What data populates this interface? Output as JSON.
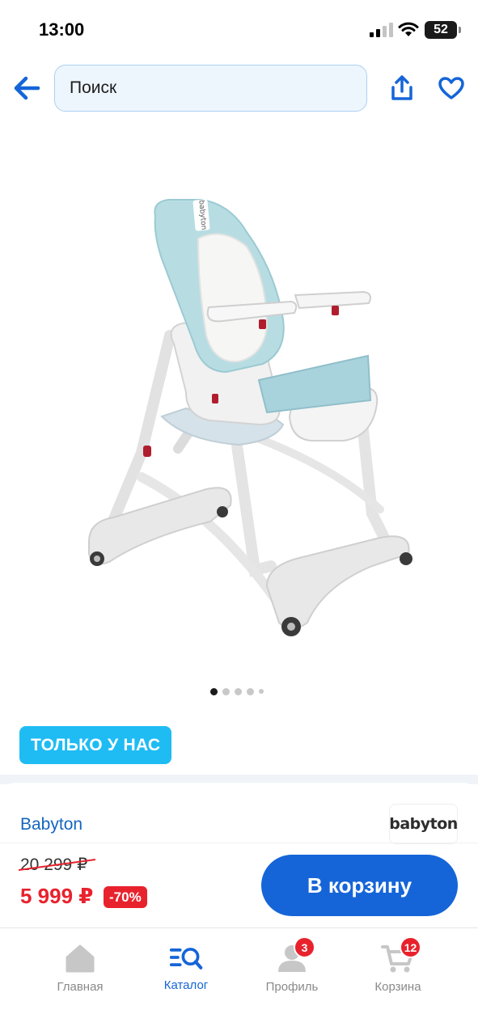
{
  "status_bar": {
    "time": "13:00",
    "battery": "52"
  },
  "header": {
    "search_placeholder": "Поиск"
  },
  "gallery": {
    "image_count": 5,
    "active_index": 0
  },
  "product": {
    "badge": "ТОЛЬКО У НАС",
    "brand": "Babyton",
    "brand_logo": "babyton",
    "image_logo": "babyton",
    "old_price": "20 299 ₽",
    "price": "5 999 ₽",
    "discount": "-70%"
  },
  "actions": {
    "add_to_cart": "В корзину"
  },
  "tab_bar": {
    "items": [
      {
        "label": "Главная",
        "icon": "home-icon",
        "badge": ""
      },
      {
        "label": "Каталог",
        "icon": "catalog-search-icon",
        "badge": ""
      },
      {
        "label": "Профиль",
        "icon": "profile-icon",
        "badge": "3"
      },
      {
        "label": "Корзина",
        "icon": "cart-icon",
        "badge": "12"
      }
    ],
    "active": "Каталог"
  },
  "colors": {
    "accent": "#1565d8",
    "sale": "#e8222d",
    "badge": "#1fbcf4"
  }
}
